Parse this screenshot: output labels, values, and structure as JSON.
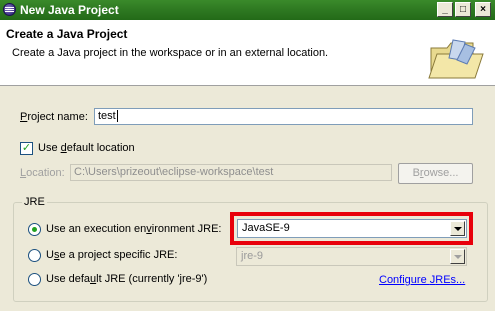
{
  "window": {
    "title": "New Java Project"
  },
  "header": {
    "title": "Create a Java Project",
    "description": "Create a Java project in the workspace or in an external location."
  },
  "project_name": {
    "label_pre": "",
    "label_key": "P",
    "label_post": "roject name:",
    "value": "test"
  },
  "use_default_location": {
    "label_pre": "Use ",
    "label_key": "d",
    "label_post": "efault location",
    "checked": true
  },
  "location": {
    "label_pre": "",
    "label_key": "L",
    "label_post": "ocation:",
    "value": "C:\\Users\\prizeout\\eclipse-workspace\\test",
    "browse_pre": "B",
    "browse_key": "r",
    "browse_post": "owse..."
  },
  "jre": {
    "group_label": "JRE",
    "exec_env": {
      "label_pre": "Use an execution en",
      "label_key": "v",
      "label_post": "ironment JRE:",
      "value": "JavaSE-9",
      "selected": true
    },
    "project_specific": {
      "label_pre": "U",
      "label_key": "s",
      "label_post": "e a project specific JRE:",
      "value": "jre-9"
    },
    "default": {
      "label_pre": "Use defa",
      "label_key": "u",
      "label_post": "lt JRE (currently 'jre-9')",
      "configure_pre": "Configure ",
      "configure_key": "J",
      "configure_post": "REs..."
    }
  },
  "colors": {
    "highlight": "#e8000b",
    "titlebar": "#2f7a22",
    "link": "#0000ff"
  }
}
